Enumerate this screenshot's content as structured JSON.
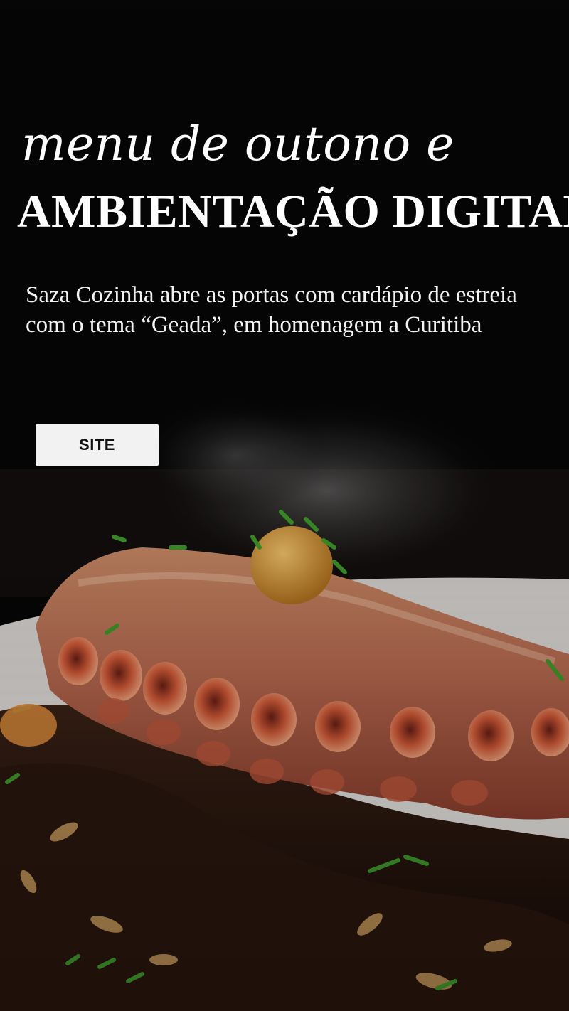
{
  "hero": {
    "title_line1": "menu de outono e",
    "title_line2": "AMBIENTAÇÃO DIGITAL",
    "subtitle": "Saza Cozinha abre as portas com cardápio de estreia com o tema “Geada”, em homenagem a Curitiba",
    "cta_label": "SITE"
  },
  "colors": {
    "background": "#050505",
    "text": "#ffffff",
    "button_bg": "#f2f2f2",
    "button_text": "#111111"
  },
  "image": {
    "subject": "grilled-octopus-dish"
  }
}
